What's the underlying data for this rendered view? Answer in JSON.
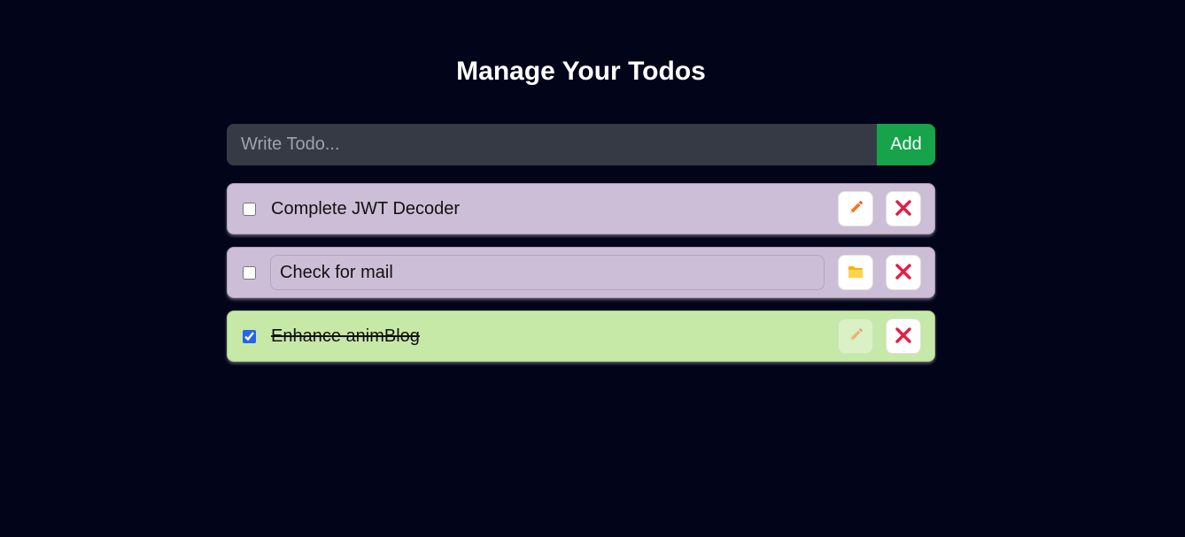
{
  "title": "Manage Your Todos",
  "form": {
    "placeholder": "Write Todo...",
    "value": "",
    "add_label": "Add"
  },
  "todos": [
    {
      "text": "Complete JWT Decoder",
      "completed": false,
      "editing": false,
      "edit_icon": "pencil-icon",
      "delete_icon": "close-icon"
    },
    {
      "text": "Check for mail",
      "completed": false,
      "editing": true,
      "edit_icon": "folder-icon",
      "delete_icon": "close-icon"
    },
    {
      "text": "Enhance animBlog",
      "completed": true,
      "editing": false,
      "edit_icon": "pencil-icon",
      "delete_icon": "close-icon"
    }
  ],
  "colors": {
    "background": "#02051a",
    "pending_card": "#ccbed7",
    "completed_card": "#c6e9a7",
    "add_button": "#16a34a",
    "delete_icon": "#e11d48",
    "pencil_icon": "#f97316",
    "folder_icon": "#facc15"
  }
}
